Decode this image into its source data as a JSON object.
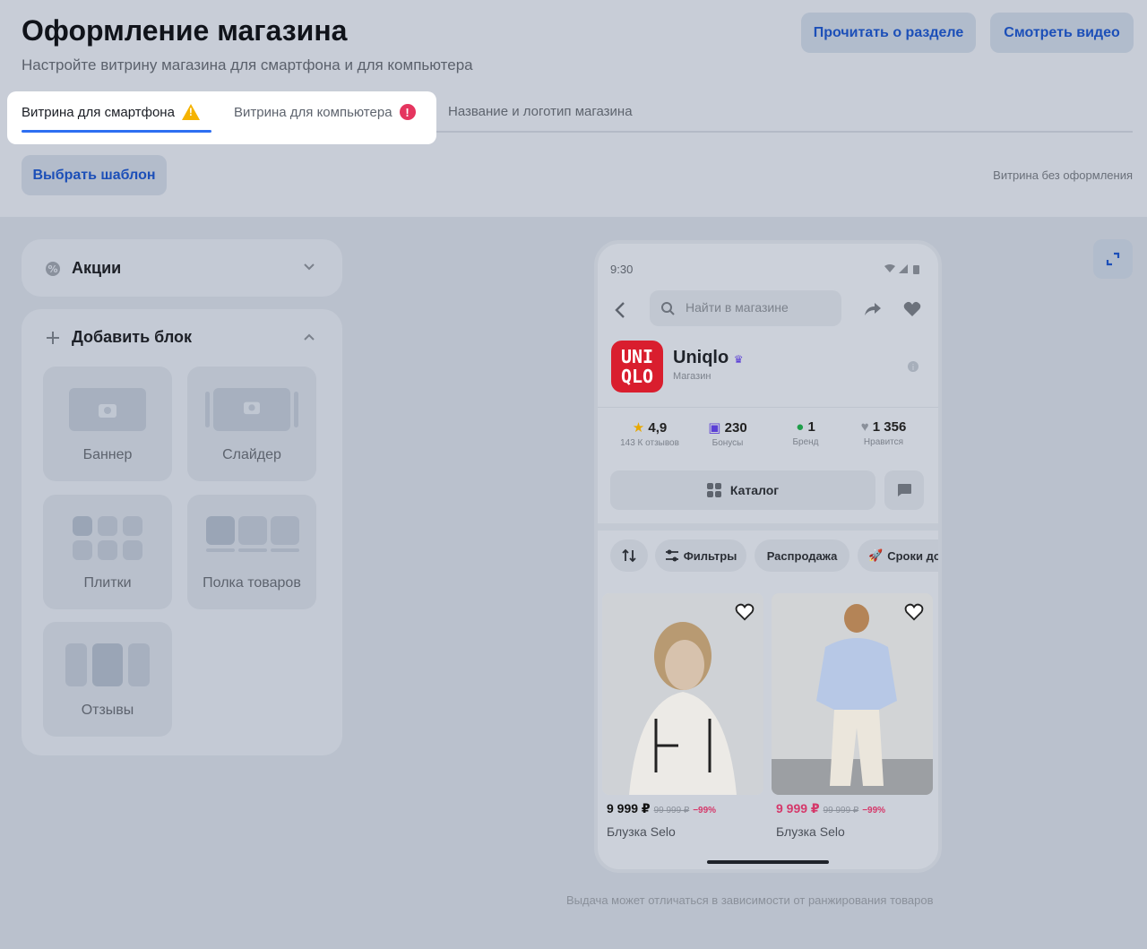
{
  "header": {
    "title": "Оформление магазина",
    "subtitle": "Настройте витрину магазина для смартфона и для компьютера",
    "read_button": "Прочитать о разделе",
    "video_button": "Смотреть видео"
  },
  "tabs": [
    {
      "label": "Витрина для смартфона",
      "status": "warning"
    },
    {
      "label": "Витрина для компьютера",
      "status": "error"
    },
    {
      "label": "Название и логотип магазина",
      "status": "none"
    }
  ],
  "toolbar": {
    "template_button": "Выбрать шаблон",
    "no_design_label": "Витрина без оформления"
  },
  "sidebar": {
    "promo_section": "Акции",
    "add_block_section": "Добавить блок",
    "blocks": [
      "Баннер",
      "Слайдер",
      "Плитки",
      "Полка товаров",
      "Отзывы"
    ]
  },
  "phone": {
    "time": "9:30",
    "search_placeholder": "Найти в магазине",
    "shop_name": "Uniqlo",
    "shop_type": "Магазин",
    "logo_lines": [
      "UNI",
      "QLO"
    ],
    "stats": [
      {
        "value": "4,9",
        "label": "143 К отзывов",
        "icon": "star-icon"
      },
      {
        "value": "230",
        "label": "Бонусы",
        "icon": "bonus-icon"
      },
      {
        "value": "1",
        "label": "Бренд",
        "icon": "check-icon"
      },
      {
        "value": "1 356",
        "label": "Нравится",
        "icon": "heart-icon"
      }
    ],
    "catalog_button": "Каталог",
    "chips": [
      "Фильтры",
      "Распродажа",
      "Сроки до"
    ],
    "products": [
      {
        "price": "9 999 ₽",
        "old_price": "99 999 ₽",
        "discount": "−99%",
        "name": "Блузка Selo"
      },
      {
        "price": "9 999 ₽",
        "old_price": "99 999 ₽",
        "discount": "−99%",
        "name": "Блузка Selo"
      }
    ]
  },
  "footer_note": "Выдача может отличаться в зависимости от ранжирования товаров",
  "colors": {
    "accent": "#2e6ff2",
    "brand": "#d91e2e",
    "warning": "#f5b301",
    "error": "#e5355f"
  }
}
